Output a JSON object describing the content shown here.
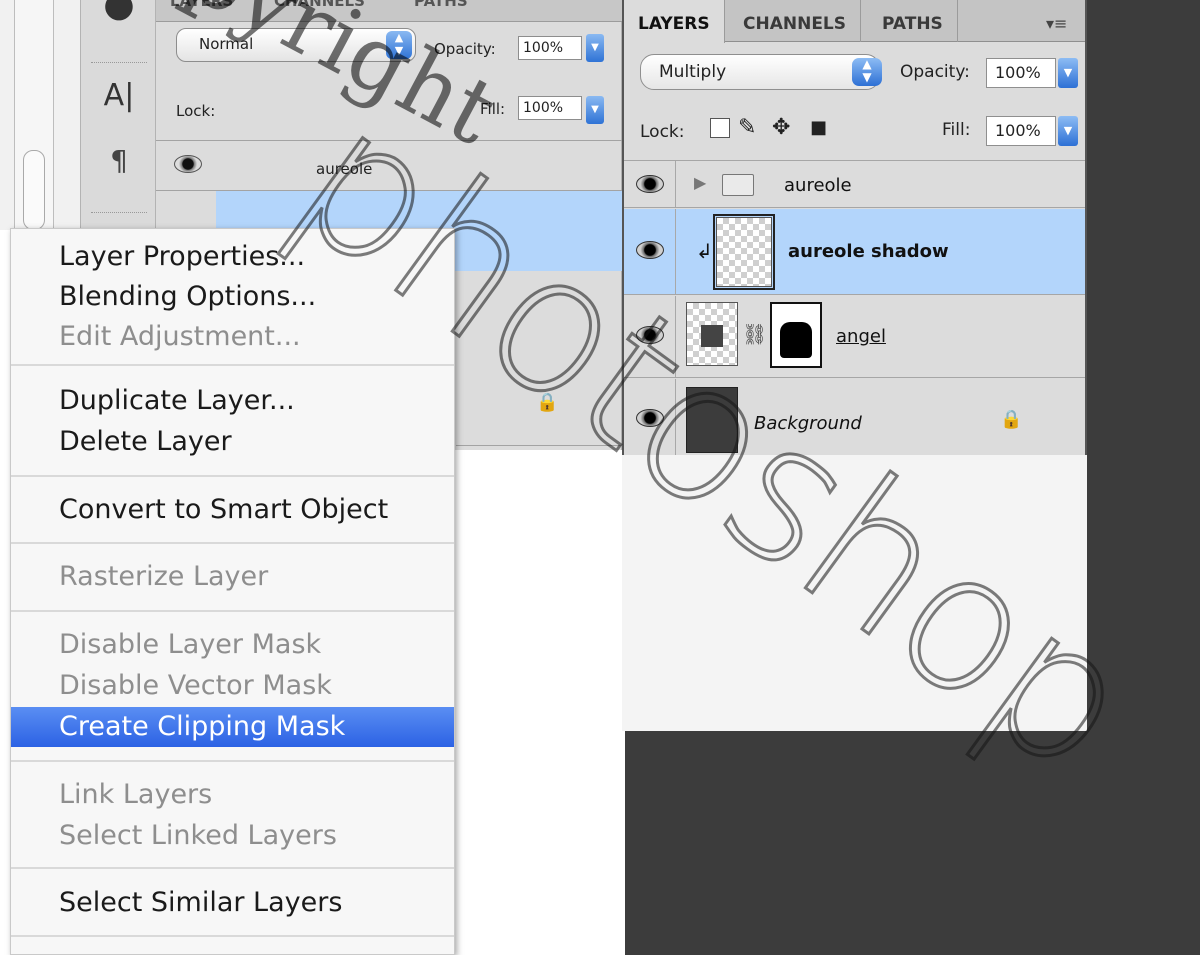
{
  "left_panel": {
    "tabs": [
      "LAYERS",
      "CHANNELS",
      "PATHS"
    ],
    "blend_mode": "Normal",
    "opacity_label": "Opacity:",
    "opacity_value": "100%",
    "lock_label": "Lock:",
    "fill_label": "Fill:",
    "fill_value": "100%",
    "layers": [
      {
        "name": "aureole"
      }
    ]
  },
  "context_menu": {
    "items": [
      {
        "label": "Layer Properties...",
        "enabled": true
      },
      {
        "label": "Blending Options...",
        "enabled": true
      },
      {
        "label": "Edit Adjustment...",
        "enabled": false
      },
      {
        "label": "Duplicate Layer...",
        "enabled": true
      },
      {
        "label": "Delete Layer",
        "enabled": true
      },
      {
        "label": "Convert to Smart Object",
        "enabled": true
      },
      {
        "label": "Rasterize Layer",
        "enabled": false
      },
      {
        "label": "Disable Layer Mask",
        "enabled": false
      },
      {
        "label": "Disable Vector Mask",
        "enabled": false
      },
      {
        "label": "Create Clipping Mask",
        "enabled": true,
        "highlighted": true
      },
      {
        "label": "Link Layers",
        "enabled": false
      },
      {
        "label": "Select Linked Layers",
        "enabled": false
      },
      {
        "label": "Select Similar Layers",
        "enabled": true
      }
    ]
  },
  "right_panel": {
    "tabs": [
      "LAYERS",
      "CHANNELS",
      "PATHS"
    ],
    "active_tab": "LAYERS",
    "blend_mode": "Multiply",
    "opacity_label": "Opacity:",
    "opacity_value": "100%",
    "lock_label": "Lock:",
    "fill_label": "Fill:",
    "fill_value": "100%",
    "layers": [
      {
        "name": "aureole",
        "type": "group",
        "visible": true
      },
      {
        "name": "aureole shadow",
        "type": "clipped-layer",
        "visible": true,
        "selected": true
      },
      {
        "name": "angel",
        "type": "masked-layer",
        "visible": true
      },
      {
        "name": "Background",
        "type": "background",
        "visible": true,
        "locked": true
      }
    ]
  },
  "watermark": {
    "main": "copyright",
    "secondary": "Copyright",
    "tertiary": "photoshop"
  },
  "colors": {
    "menu_highlight": "#2c62e4",
    "selected_layer": "#b3d5fb",
    "dark_background": "#3c3c3c",
    "panel_gray": "#dcdcdc"
  }
}
